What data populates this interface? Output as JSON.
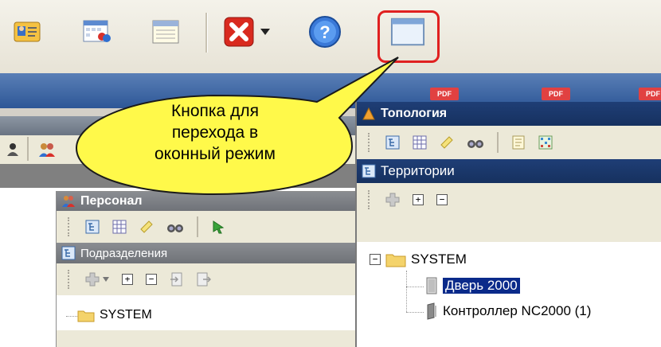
{
  "colors": {
    "highlight": "#e02020",
    "callout_fill": "#fff94a",
    "title_blue": "#1f3e76",
    "selection_blue": "#0a2a8a"
  },
  "toolbar": {
    "buttons": [
      {
        "name": "contact-card-icon"
      },
      {
        "name": "calendar-people-icon"
      },
      {
        "name": "schedule-icon"
      },
      {
        "name": "delete-icon"
      },
      {
        "name": "dropdown-arrow-icon"
      },
      {
        "name": "help-icon"
      },
      {
        "name": "window-mode-icon"
      }
    ]
  },
  "pdf_tabs": [
    "PDF",
    "PDF",
    "PDF"
  ],
  "callout": {
    "lines": [
      "Кнопка для",
      "перехода в",
      "оконный режим"
    ]
  },
  "personal_window": {
    "title": "Персонал",
    "subhead": "Подразделения",
    "tree_root": "SYSTEM"
  },
  "topology_window": {
    "title": "Топология",
    "subhead": "Территории",
    "tree": {
      "root": "SYSTEM",
      "items": [
        "Дверь 2000",
        "Контроллер NC2000 (1)"
      ]
    }
  }
}
